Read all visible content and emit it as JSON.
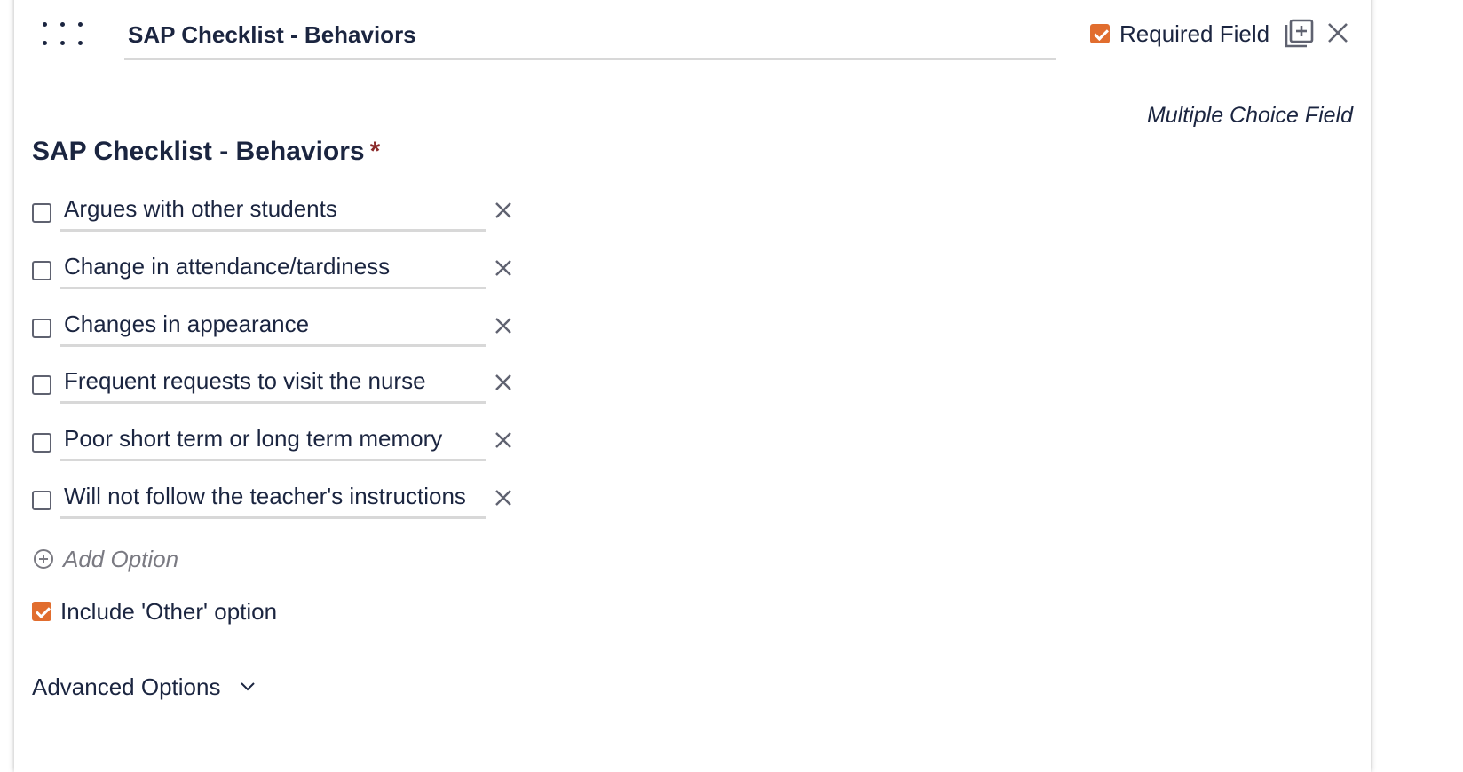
{
  "field": {
    "title_value": "SAP Checklist - Behaviors",
    "required_label": "Required Field",
    "required_checked": true,
    "type_label": "Multiple Choice Field",
    "preview_heading": "SAP Checklist - Behaviors",
    "required_marker": "*"
  },
  "options": [
    {
      "label": "Argues with other students",
      "checked": false
    },
    {
      "label": "Change in attendance/tardiness",
      "checked": false
    },
    {
      "label": "Changes in appearance",
      "checked": false
    },
    {
      "label": "Frequent requests to visit the nurse",
      "checked": false
    },
    {
      "label": "Poor short term or long term memory",
      "checked": false
    },
    {
      "label": "Will not follow the teacher's instructions",
      "checked": false
    }
  ],
  "add_option_label": "Add Option",
  "other_option": {
    "label": "Include 'Other' option",
    "checked": true
  },
  "advanced_label": "Advanced Options",
  "icons": {
    "drag": "drag-handle-icon",
    "copy": "duplicate-icon",
    "close": "close-icon",
    "remove_option": "close-icon",
    "add": "plus-circle-icon",
    "expand": "chevron-down-icon"
  },
  "colors": {
    "accent": "#e16d2e",
    "text": "#1b2540",
    "muted": "#7a7a82",
    "underline": "#d8d8d8",
    "asterisk": "#8b2a2a"
  }
}
